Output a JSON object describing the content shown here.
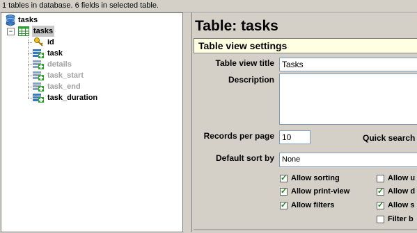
{
  "status": "1 tables in database. 6 fields in selected table.",
  "tree": {
    "root": "tasks",
    "table": "tasks",
    "collapse_symbol": "−",
    "fields": [
      {
        "name": "id",
        "disabled": false,
        "icon": "key-icon"
      },
      {
        "name": "task",
        "disabled": false,
        "icon": "field-add-icon"
      },
      {
        "name": "details",
        "disabled": true,
        "icon": "field-add-icon"
      },
      {
        "name": "task_start",
        "disabled": true,
        "icon": "field-add-icon"
      },
      {
        "name": "task_end",
        "disabled": true,
        "icon": "field-add-icon"
      },
      {
        "name": "task_duration",
        "disabled": false,
        "icon": "field-add-icon"
      }
    ]
  },
  "main": {
    "title": "Table: tasks",
    "section": "Table view settings",
    "view_title_label": "Table view title",
    "view_title_value": "Tasks",
    "description_label": "Description",
    "records_label": "Records per page",
    "records_value": "10",
    "quick_search_label": "Quick search",
    "sort_label": "Default sort by",
    "sort_value": "None",
    "checkboxes_left": [
      {
        "label": "Allow sorting",
        "checked": true
      },
      {
        "label": "Allow print-view",
        "checked": true
      },
      {
        "label": "Allow filters",
        "checked": true
      }
    ],
    "checkboxes_right": [
      {
        "label": "Allow u",
        "checked": false
      },
      {
        "label": "Allow d",
        "checked": true
      },
      {
        "label": "Allow s",
        "checked": true
      },
      {
        "label": "Filter b",
        "checked": false
      }
    ]
  },
  "colors": {
    "section_bg": "#ffffe1",
    "check": "#118811",
    "db_icon": "#3a78c8"
  }
}
